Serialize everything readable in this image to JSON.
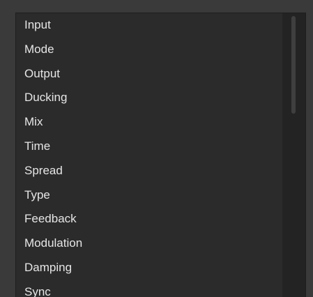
{
  "parameter_list": {
    "items": [
      {
        "label": "Input"
      },
      {
        "label": "Mode"
      },
      {
        "label": "Output"
      },
      {
        "label": "Ducking"
      },
      {
        "label": "Mix"
      },
      {
        "label": "Time"
      },
      {
        "label": "Spread"
      },
      {
        "label": "Type"
      },
      {
        "label": "Feedback"
      },
      {
        "label": "Modulation"
      },
      {
        "label": "Damping"
      },
      {
        "label": "Sync"
      }
    ]
  },
  "colors": {
    "background": "#3a3a3a",
    "panel": "#2b2b2b",
    "text": "#e6e6e6",
    "scrollbar_track": "#232323",
    "scrollbar_thumb": "#3f3f3f"
  }
}
